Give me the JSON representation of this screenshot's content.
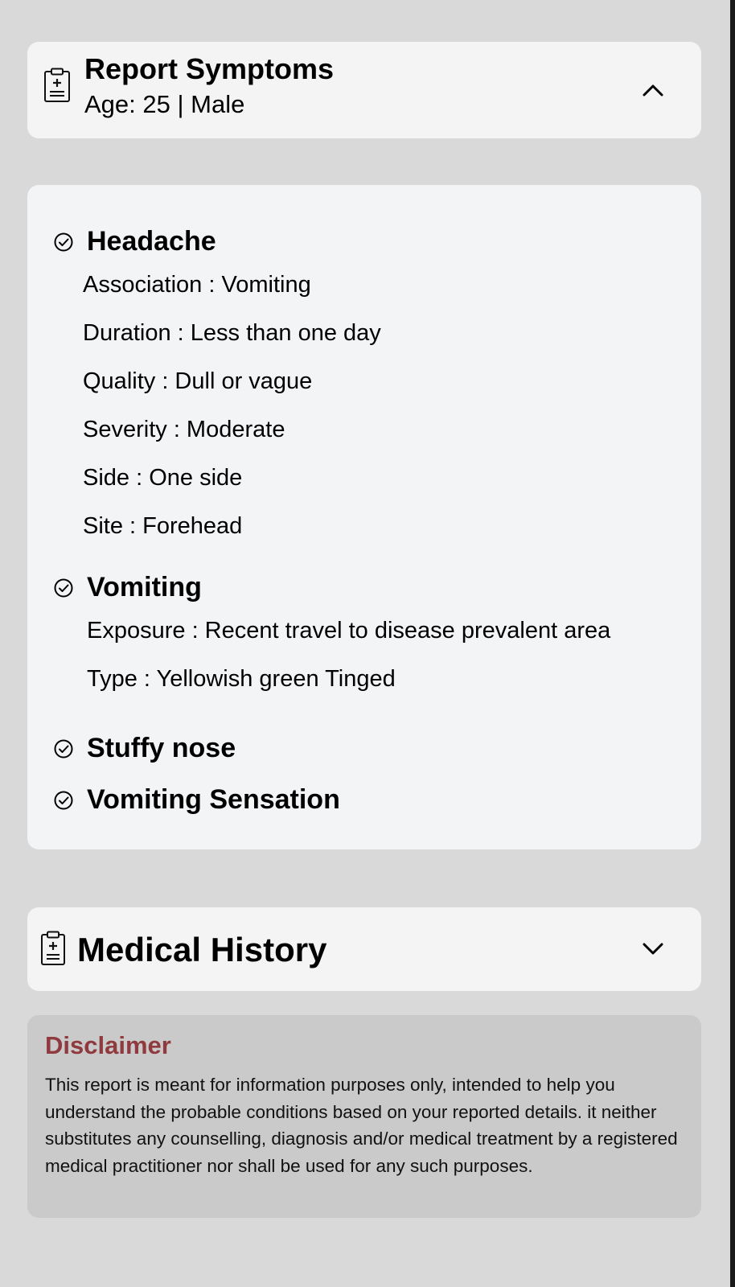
{
  "header": {
    "title": "Report Symptoms",
    "subtitle": "Age: 25 | Male",
    "icon": "clipboard-medical-icon",
    "toggle_icon": "chevron-up-icon"
  },
  "symptoms": [
    {
      "name": "Headache",
      "details": [
        "Association : Vomiting",
        "Duration : Less than one day",
        "Quality : Dull or vague",
        "Severity : Moderate",
        "Side : One side",
        "Site : Forehead"
      ]
    },
    {
      "name": "Vomiting",
      "details": [
        "Exposure : Recent travel to disease prevalent area",
        "Type : Yellowish green Tinged"
      ]
    },
    {
      "name": "Stuffy nose",
      "details": []
    },
    {
      "name": "Vomiting Sensation",
      "details": []
    }
  ],
  "medical_history": {
    "title": "Medical History",
    "icon": "clipboard-medical-icon",
    "toggle_icon": "chevron-down-icon"
  },
  "disclaimer": {
    "title": "Disclaimer",
    "text": "This report is meant for information purposes only, intended to help you understand the probable conditions based on your reported details. it neither substitutes any counselling, diagnosis and/or medical  treatment by a registered medical practitioner nor shall be used for any such purposes."
  },
  "colors": {
    "page_background": "#d9d9d9",
    "card_background": "#f4f4f4",
    "disclaimer_background": "#cacaca",
    "disclaimer_title": "#8f3a3f"
  }
}
